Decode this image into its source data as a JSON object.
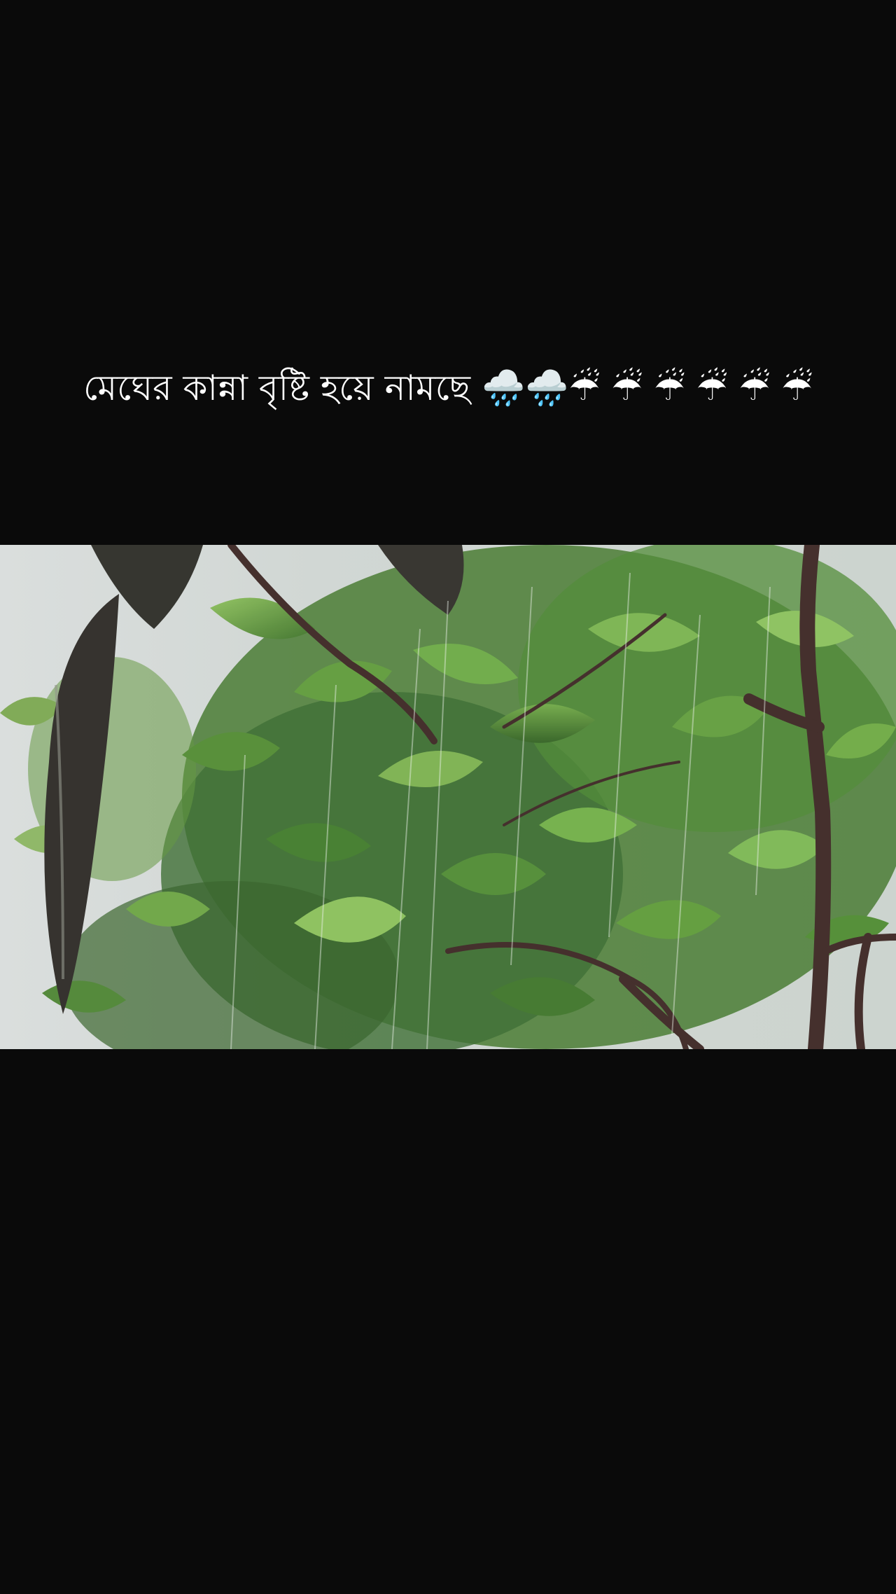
{
  "caption": {
    "text": "মেঘের কান্না বৃষ্টি হয়ে নামছে",
    "emojis": "🌧️🌧️☔ ☔ ☔ ☔ ☔ ☔"
  },
  "video": {
    "scene": "rain-on-leaves"
  },
  "colors": {
    "background": "#0a0a0a",
    "caption_text": "#ffffff",
    "sky": "#d3d8d7",
    "leaf_dark": "#2e5a1e",
    "leaf_mid": "#4c8a2c",
    "leaf_light": "#7fb24a",
    "branch": "#3a2420"
  }
}
